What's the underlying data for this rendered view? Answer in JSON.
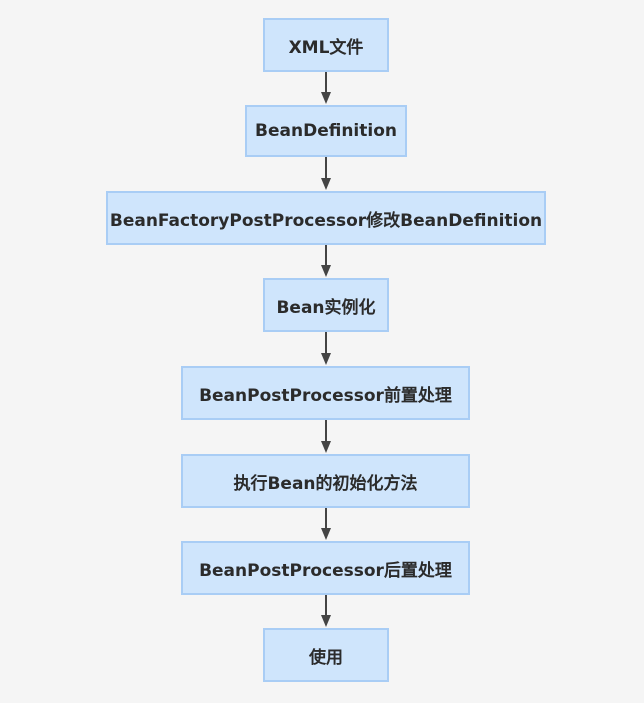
{
  "diagram": {
    "type": "flowchart",
    "direction": "top-to-bottom",
    "colors": {
      "node_fill": "#cfe5fc",
      "node_border": "#a9cdf5",
      "text": "#2b2b2b",
      "arrow": "#444444",
      "background": "#f5f5f5"
    },
    "nodes": [
      {
        "id": "n0",
        "label": "XML文件"
      },
      {
        "id": "n1",
        "label": "BeanDefinition"
      },
      {
        "id": "n2",
        "label": "BeanFactoryPostProcessor修改BeanDefinition"
      },
      {
        "id": "n3",
        "label": "Bean实例化"
      },
      {
        "id": "n4",
        "label": "BeanPostProcessor前置处理"
      },
      {
        "id": "n5",
        "label": "执行Bean的初始化方法"
      },
      {
        "id": "n6",
        "label": "BeanPostProcessor后置处理"
      },
      {
        "id": "n7",
        "label": "使用"
      }
    ],
    "edges": [
      {
        "from": "n0",
        "to": "n1"
      },
      {
        "from": "n1",
        "to": "n2"
      },
      {
        "from": "n2",
        "to": "n3"
      },
      {
        "from": "n3",
        "to": "n4"
      },
      {
        "from": "n4",
        "to": "n5"
      },
      {
        "from": "n5",
        "to": "n6"
      },
      {
        "from": "n6",
        "to": "n7"
      }
    ]
  }
}
